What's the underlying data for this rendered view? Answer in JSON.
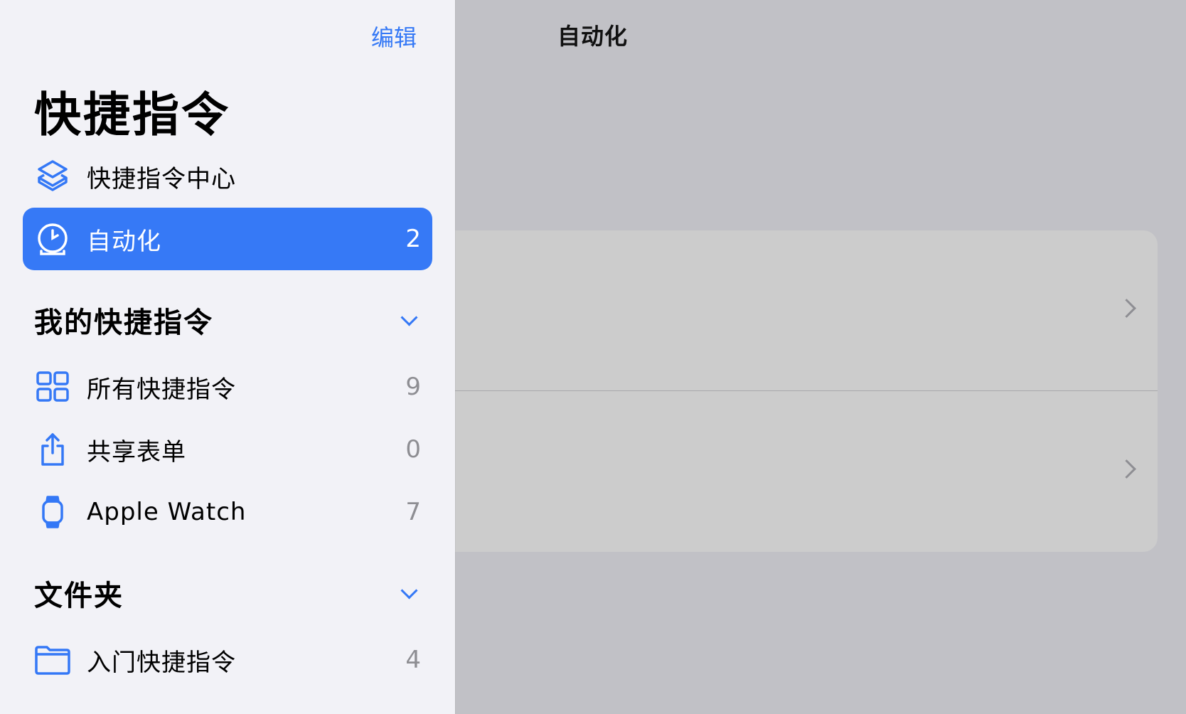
{
  "colors": {
    "accent": "#3478f6",
    "selected_bg": "#3679f6",
    "sidebar_bg": "#f2f2f7",
    "dim_bg": "#c1c1c6"
  },
  "main": {
    "title": "自动化"
  },
  "sidebar": {
    "edit_label": "编辑",
    "title": "快捷指令",
    "nav": [
      {
        "label": "快捷指令中心",
        "icon": "layers-icon"
      },
      {
        "label": "自动化",
        "count": "2",
        "icon": "clock-icon",
        "selected": true
      }
    ],
    "sections": [
      {
        "title": "我的快捷指令",
        "items": [
          {
            "label": "所有快捷指令",
            "count": "9",
            "icon": "grid-icon"
          },
          {
            "label": "共享表单",
            "count": "0",
            "icon": "share-icon"
          },
          {
            "label": "Apple Watch",
            "count": "7",
            "icon": "watch-icon"
          }
        ]
      },
      {
        "title": "文件夹",
        "items": [
          {
            "label": "入门快捷指令",
            "count": "4",
            "icon": "folder-icon"
          }
        ]
      }
    ]
  }
}
